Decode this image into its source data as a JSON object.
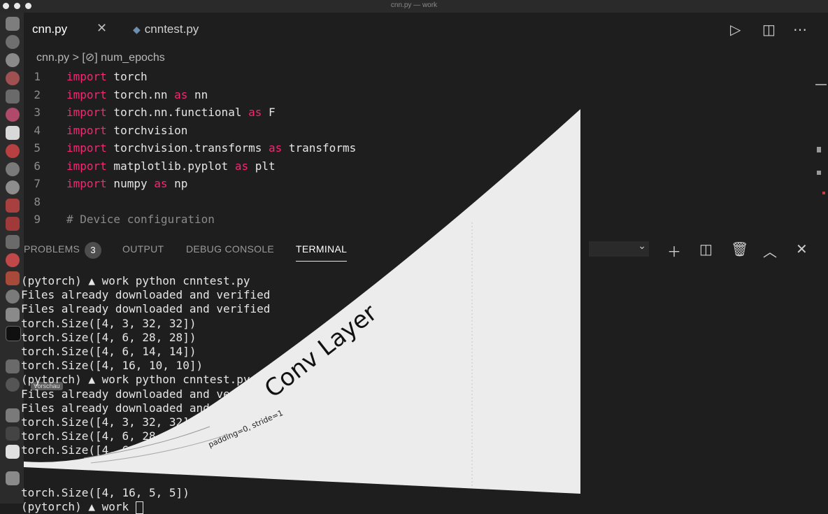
{
  "window": {
    "title": "cnn.py — work"
  },
  "tabs": [
    {
      "label": "cnn.py",
      "active": true
    },
    {
      "label": "cnntest.py",
      "active": false,
      "icon": "python-icon"
    }
  ],
  "toolbar": {
    "run_icon": "play-icon",
    "split_icon": "split-editor-icon",
    "more_icon": "ellipsis-icon"
  },
  "breadcrumb": {
    "file": "cnn.py",
    "separator": ">",
    "symbol_icon": "variable-icon",
    "symbol": "num_epochs"
  },
  "code": [
    {
      "n": "1",
      "kw1": "import",
      "mid": " torch",
      "kw2": "",
      "tail": ""
    },
    {
      "n": "2",
      "kw1": "import",
      "mid": " torch.nn ",
      "kw2": "as",
      "tail": " nn"
    },
    {
      "n": "3",
      "kw1": "import",
      "mid": " torch.nn.functional ",
      "kw2": "as",
      "tail": " F"
    },
    {
      "n": "4",
      "kw1": "import",
      "mid": " torchvision",
      "kw2": "",
      "tail": ""
    },
    {
      "n": "5",
      "kw1": "import",
      "mid": " torchvision.transforms ",
      "kw2": "as",
      "tail": " transforms"
    },
    {
      "n": "6",
      "kw1": "import",
      "mid": " matplotlib.pyplot ",
      "kw2": "as",
      "tail": " plt"
    },
    {
      "n": "7",
      "kw1": "import",
      "mid": " numpy ",
      "kw2": "as",
      "tail": " np"
    },
    {
      "n": "8",
      "kw1": "",
      "mid": "",
      "kw2": "",
      "tail": ""
    },
    {
      "n": "9",
      "comment": "# Device configuration"
    }
  ],
  "panel": {
    "tabs": {
      "problems": "PROBLEMS",
      "problems_count": "3",
      "output": "OUTPUT",
      "debug": "DEBUG CONSOLE",
      "terminal": "TERMINAL"
    },
    "icons": [
      "add-terminal-icon",
      "split-terminal-icon",
      "trash-icon",
      "chevron-up-icon",
      "close-icon"
    ]
  },
  "terminal": [
    "(pytorch) ▲ work python cnntest.py",
    "Files already downloaded and verified",
    "Files already downloaded and verified",
    "torch.Size([4, 3, 32, 32])",
    "torch.Size([4, 6, 28, 28])",
    "torch.Size([4, 6, 14, 14])",
    "torch.Size([4, 16, 10, 10])",
    "(pytorch) ▲ work python cnntest.py",
    "Files already downloaded and verified",
    "Files already downloaded and verified",
    "torch.Size([4, 3, 32, 32])",
    "torch.Size([4, 6, 28, 28])",
    "torch.Size([4, 6, 14, 14])",
    "",
    "",
    "torch.Size([4, 16, 5, 5])",
    "(pytorch) ▲ work "
  ],
  "dock": {
    "tooltip": "Vorschau"
  },
  "slide": {
    "title": "Conv Layer",
    "caption": "padding=0, stride=1"
  },
  "colors": {
    "keyword": "#f92672",
    "background": "#1e1e1e",
    "dock": "#2b2b2b"
  }
}
